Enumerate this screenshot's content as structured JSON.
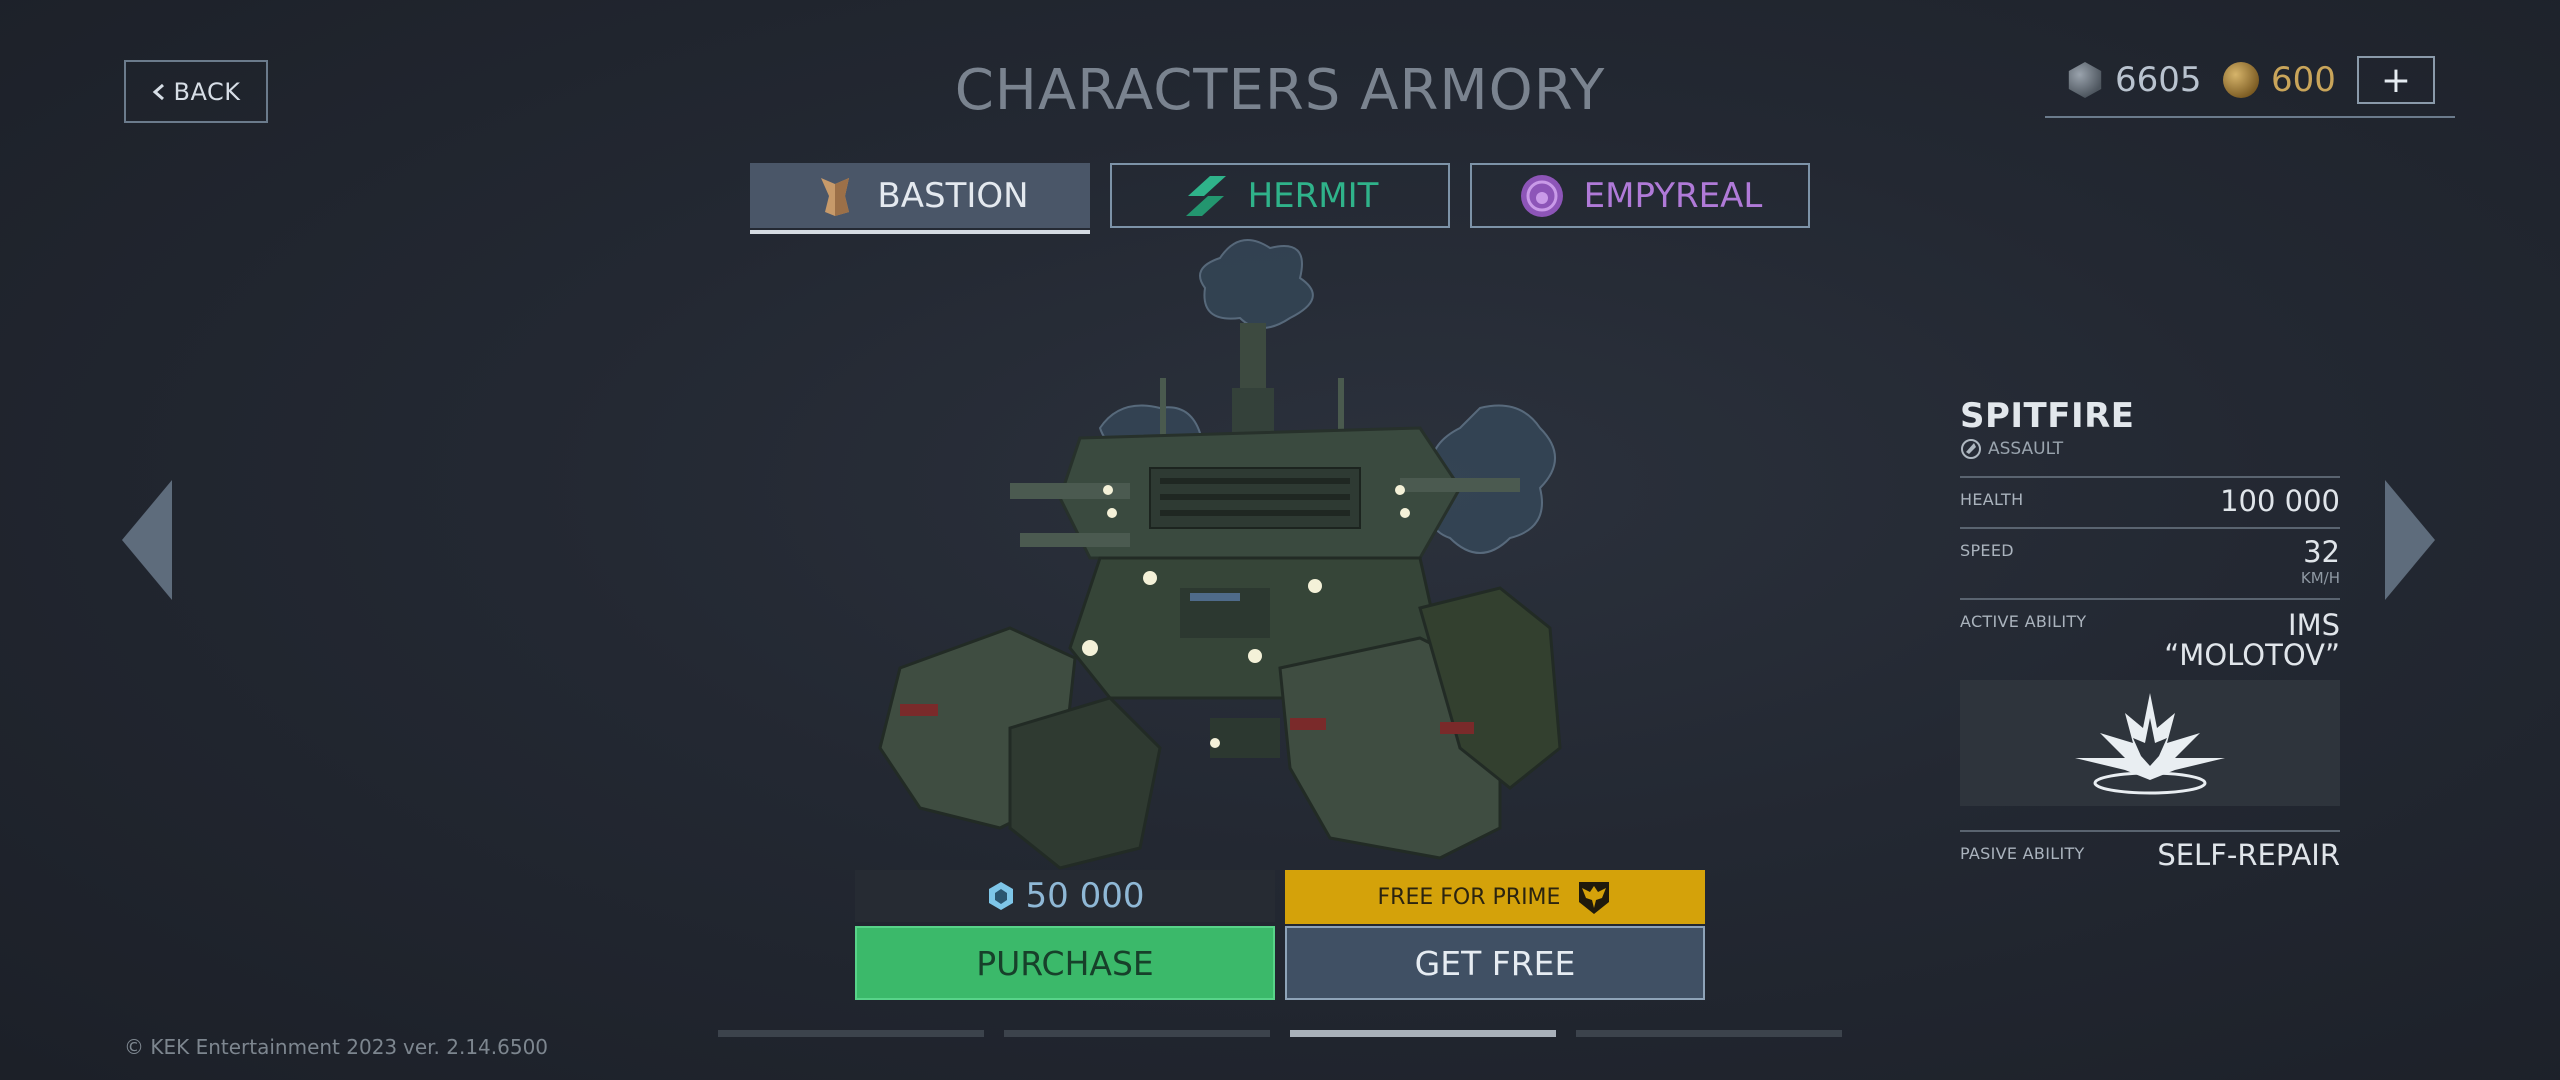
{
  "header": {
    "back_label": "BACK",
    "title": "CHARACTERS ARMORY"
  },
  "currency": {
    "silver": "6605",
    "gold": "600",
    "add_label": "+"
  },
  "tabs": [
    {
      "label": "BASTION",
      "icon": "bastion-faction-icon",
      "color": "#c79a6a",
      "active": true
    },
    {
      "label": "HERMIT",
      "icon": "hermit-faction-icon",
      "color": "#2fb38a",
      "active": false
    },
    {
      "label": "EMPYREAL",
      "icon": "empyreal-faction-icon",
      "color": "#b07ad8",
      "active": false
    }
  ],
  "robot": {
    "name": "SPITFIRE",
    "class": "ASSAULT",
    "stats": {
      "health_label": "HEALTH",
      "health_value": "100 000",
      "speed_label": "SPEED",
      "speed_value": "32",
      "speed_unit": "KM/H",
      "active_label": "ACTIVE ABILITY",
      "active_value_line1": "IMS",
      "active_value_line2": "“MOLOTOV”",
      "passive_label": "PASIVE  ABILITY",
      "passive_value": "SELF-REPAIR"
    }
  },
  "purchase": {
    "price": "50 000",
    "price_icon": "hex-currency-icon",
    "prime_label": "FREE FOR PRIME",
    "prime_icon": "eagle-emblem-icon",
    "purchase_label": "PURCHASE",
    "get_free_label": "GET FREE"
  },
  "pager": {
    "count": 4,
    "active_index": 2
  },
  "footer": {
    "copyright": "© KEK Entertainment 2023",
    "version": "ver. 2.14.6500"
  },
  "colors": {
    "accent_green": "#3bb96a",
    "prime_gold": "#d4a20a",
    "background": "#232832"
  }
}
